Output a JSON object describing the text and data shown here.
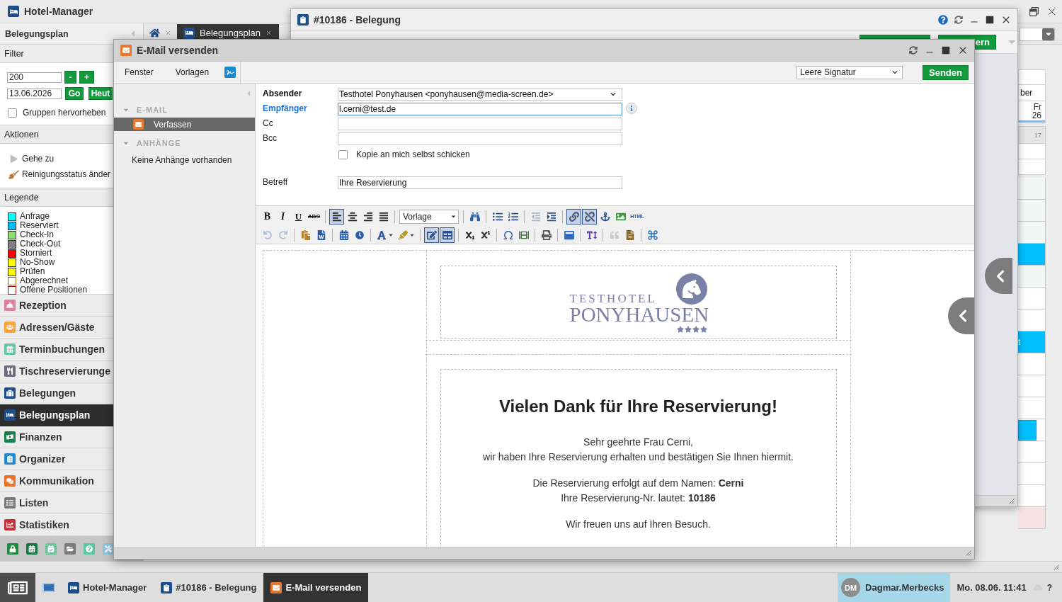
{
  "main_window": {
    "title": "Hotel-Manager",
    "tabs": [
      {
        "kind": "home",
        "selected": false
      },
      {
        "kind": "page",
        "label": "Belegungsplan",
        "selected": true
      }
    ],
    "calendar": {
      "month": "ber",
      "weekday": "Fr",
      "day": "26",
      "summary": "17",
      "rows": [
        {
          "kind": "shaded"
        },
        {
          "kind": "shaded"
        },
        {
          "kind": "shaded"
        },
        {
          "kind": "booked"
        },
        {
          "kind": "shaded"
        },
        {
          "kind": "free"
        },
        {
          "kind": "free"
        },
        {
          "kind": "booked",
          "label": "t"
        },
        {
          "kind": "free"
        },
        {
          "kind": "free"
        },
        {
          "kind": "free"
        },
        {
          "kind": "partial"
        },
        {
          "kind": "free"
        },
        {
          "kind": "free"
        },
        {
          "kind": "free"
        },
        {
          "kind": "blocked"
        }
      ]
    }
  },
  "sidebar": {
    "title": "Belegungsplan",
    "filter": {
      "title": "Filter",
      "quantity": "200",
      "decrease": "-",
      "increase": "+",
      "date": "13.06.2026",
      "go": "Go",
      "today": "Heut",
      "highlight_groups": {
        "label": "Gruppen hervorheben",
        "checked": false
      }
    },
    "actions": {
      "title": "Aktionen",
      "items": [
        {
          "label": "Gehe zu"
        },
        {
          "label": "Reinigungsstatus änder"
        }
      ]
    },
    "legend": {
      "title": "Legende",
      "items": [
        {
          "label": "Anfrage",
          "color": "#00ffff",
          "kind": "fill"
        },
        {
          "label": "Reserviert",
          "color": "#00bfff",
          "kind": "fill"
        },
        {
          "label": "Check-In",
          "color": "#8ee06e",
          "kind": "fill"
        },
        {
          "label": "Check-Out",
          "color": "#808080",
          "kind": "fill"
        },
        {
          "label": "Storniert",
          "color": "#ff0000",
          "kind": "fill"
        },
        {
          "label": "No-Show",
          "color": "#ffff00",
          "kind": "fill"
        },
        {
          "label": "Prüfen",
          "color": "#ffff00",
          "kind": "fill"
        },
        {
          "label": "Abgerechnet",
          "color": "#9c5a1e",
          "kind": "outline"
        },
        {
          "label": "Offene Positionen",
          "color": "#a01818",
          "kind": "outline"
        }
      ]
    },
    "nav": [
      {
        "label": "Rezeption",
        "selected": false
      },
      {
        "label": "Adressen/Gäste",
        "selected": false
      },
      {
        "label": "Terminbuchungen",
        "selected": false
      },
      {
        "label": "Tischreservierunge",
        "selected": false
      },
      {
        "label": "Belegungen",
        "selected": false
      },
      {
        "label": "Belegungsplan",
        "selected": true
      },
      {
        "label": "Finanzen",
        "selected": false
      },
      {
        "label": "Organizer",
        "selected": false
      },
      {
        "label": "Kommunikation",
        "selected": false
      },
      {
        "label": "Listen",
        "selected": false
      },
      {
        "label": "Statistiken",
        "selected": false
      }
    ]
  },
  "booking_window": {
    "title": "#10186 - Belegung",
    "action_button": "ern"
  },
  "email_window": {
    "title": "E-Mail versenden",
    "menu": [
      "Fenster",
      "Vorlagen"
    ],
    "signature": "Leere Signatur",
    "send": "Senden",
    "sections": [
      {
        "title": "E-MAIL",
        "expanded": true,
        "items": [
          {
            "label": "Verfassen",
            "selected": true
          }
        ]
      },
      {
        "title": "ANHÄNGE",
        "expanded": true,
        "empty_text": "Keine Anhänge vorhanden"
      }
    ],
    "fields": [
      {
        "kind": "select",
        "label": "Absender",
        "bold": true,
        "link": false,
        "value": "Testhotel Ponyhausen <ponyhausen@media-screen.de>",
        "focused": false,
        "info": false
      },
      {
        "kind": "input",
        "label": "Empfänger",
        "bold": true,
        "link": true,
        "value": "l.cerni@test.de",
        "focused": true,
        "info": true
      },
      {
        "kind": "input",
        "label": "Cc",
        "bold": false,
        "link": false,
        "focused": false,
        "info": false
      },
      {
        "kind": "input",
        "label": "Bcc",
        "bold": false,
        "link": false,
        "focused": false,
        "info": false
      },
      {
        "kind": "checkbox",
        "label": "Kopie an mich selbst schicken",
        "checked": false
      },
      {
        "kind": "input",
        "label": "Betreff",
        "bold": false,
        "link": false,
        "value": "Ihre Reservierung",
        "focused": false,
        "info": false
      }
    ],
    "editor": {
      "toolbar": [
        [
          {
            "buttons": [
              {
                "kind": "bold",
                "label": "B",
                "active": false,
                "disabled": false
              },
              {
                "kind": "italic",
                "label": "I",
                "active": false,
                "disabled": false
              },
              {
                "kind": "underline",
                "label": "U",
                "active": false,
                "disabled": false
              },
              {
                "kind": "strikethrough",
                "label": "ABC",
                "active": false,
                "disabled": false
              }
            ]
          },
          {
            "buttons": [
              {
                "kind": "alignleft",
                "active": true,
                "disabled": false
              },
              {
                "kind": "aligncenter",
                "active": false,
                "disabled": false
              },
              {
                "kind": "alignright",
                "active": false,
                "disabled": false
              },
              {
                "kind": "alignjustify",
                "active": false,
                "disabled": false
              }
            ]
          },
          {
            "select": "Vorlage"
          },
          {
            "buttons": [
              {
                "kind": "find",
                "active": false,
                "disabled": false
              }
            ]
          },
          {
            "buttons": [
              {
                "kind": "bullist",
                "active": false,
                "disabled": false
              },
              {
                "kind": "numlist",
                "active": false,
                "disabled": false
              }
            ]
          },
          {
            "buttons": [
              {
                "kind": "outdent",
                "active": false,
                "disabled": true
              },
              {
                "kind": "indent",
                "active": false,
                "disabled": false
              }
            ]
          },
          {
            "buttons": [
              {
                "kind": "link",
                "active": true,
                "disabled": false
              },
              {
                "kind": "unlink",
                "active": true,
                "disabled": false
              },
              {
                "kind": "anchor",
                "active": false,
                "disabled": false
              },
              {
                "kind": "image",
                "active": false,
                "disabled": false
              },
              {
                "kind": "html",
                "label": "HTML",
                "active": false,
                "disabled": false
              }
            ]
          }
        ],
        [
          {
            "buttons": [
              {
                "kind": "undo",
                "active": false,
                "disabled": true
              },
              {
                "kind": "redo",
                "active": false,
                "disabled": true
              }
            ]
          },
          {
            "buttons": [
              {
                "kind": "pastetext",
                "active": false,
                "disabled": false
              },
              {
                "kind": "pasteword",
                "active": false,
                "disabled": false
              }
            ]
          },
          {
            "buttons": [
              {
                "kind": "insertdate",
                "active": false,
                "disabled": false
              },
              {
                "kind": "inserttime",
                "active": false,
                "disabled": false
              }
            ]
          },
          {
            "buttons": [
              {
                "kind": "forecolor",
                "active": false,
                "disabled": false
              },
              {
                "kind": "backcolor",
                "active": false,
                "disabled": false
              }
            ]
          },
          {
            "buttons": [
              {
                "kind": "visualaid",
                "active": true,
                "disabled": false
              },
              {
                "kind": "table",
                "active": true,
                "disabled": false
              }
            ]
          },
          {
            "buttons": [
              {
                "kind": "subscript",
                "active": false,
                "disabled": false
              },
              {
                "kind": "superscript",
                "active": false,
                "disabled": false
              }
            ]
          },
          {
            "buttons": [
              {
                "kind": "charmap",
                "active": false,
                "disabled": false
              },
              {
                "kind": "media",
                "active": false,
                "disabled": false
              }
            ]
          },
          {
            "buttons": [
              {
                "kind": "print",
                "active": false,
                "disabled": false
              }
            ]
          },
          {
            "buttons": [
              {
                "kind": "iframe",
                "active": false,
                "disabled": false
              }
            ]
          },
          {
            "buttons": [
              {
                "kind": "styles",
                "active": false,
                "disabled": false
              }
            ]
          },
          {
            "buttons": [
              {
                "kind": "blockquote",
                "active": false,
                "disabled": true
              },
              {
                "kind": "template",
                "active": false,
                "disabled": false
              }
            ]
          },
          {
            "buttons": [
              {
                "kind": "shortcuts",
                "active": false,
                "disabled": false
              }
            ]
          }
        ]
      ],
      "template": {
        "logo": {
          "line_1": "TESTHOTEL",
          "line_2": "PONYHAUSEN",
          "stars": 4
        },
        "heading": "Vielen Dank für Ihre Reservierung!",
        "paragraphs": [
          [
            "Sehr geehrte Frau Cerni,",
            "wir haben Ihre Reservierung erhalten und bestätigen Sie Ihnen hiermit."
          ],
          [
            "Die Reservierung erfolgt auf dem Namen: **Cerni**",
            "Ihre Reservierung-Nr. lautet: **10186**"
          ],
          [
            "Wir freuen uns auf Ihren Besuch."
          ]
        ]
      }
    }
  },
  "taskbar": {
    "windows": [
      {
        "label": "Hotel-Manager",
        "selected": false
      },
      {
        "label": "#10186 - Belegung",
        "selected": false
      },
      {
        "label": "E-Mail versenden",
        "selected": true
      }
    ],
    "user": {
      "initials": "DM",
      "name": "Dagmar.Merbecks"
    },
    "clock": "Mo. 08.06. 11:41",
    "help": "?"
  }
}
